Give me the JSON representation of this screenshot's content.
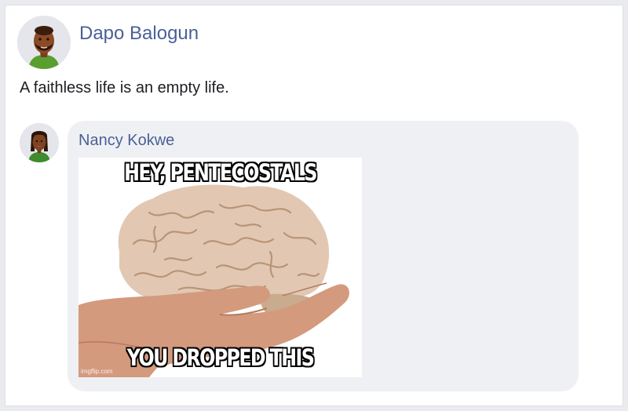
{
  "post": {
    "author": "Dapo Balogun",
    "avatar_icon": "man-avatar-icon",
    "text": "A faithless life is an empty life."
  },
  "comment": {
    "author": "Nancy Kokwe",
    "avatar_icon": "woman-avatar-icon",
    "image": {
      "subject": "brain-held-in-hand",
      "caption_top": "HEY, PENTECOSTALS",
      "caption_bottom": "YOU DROPPED THIS",
      "watermark": "imgflip.com"
    }
  },
  "colors": {
    "name_link": "#4a6197",
    "bubble": "#eff0f3",
    "background": "#e9ebee"
  }
}
